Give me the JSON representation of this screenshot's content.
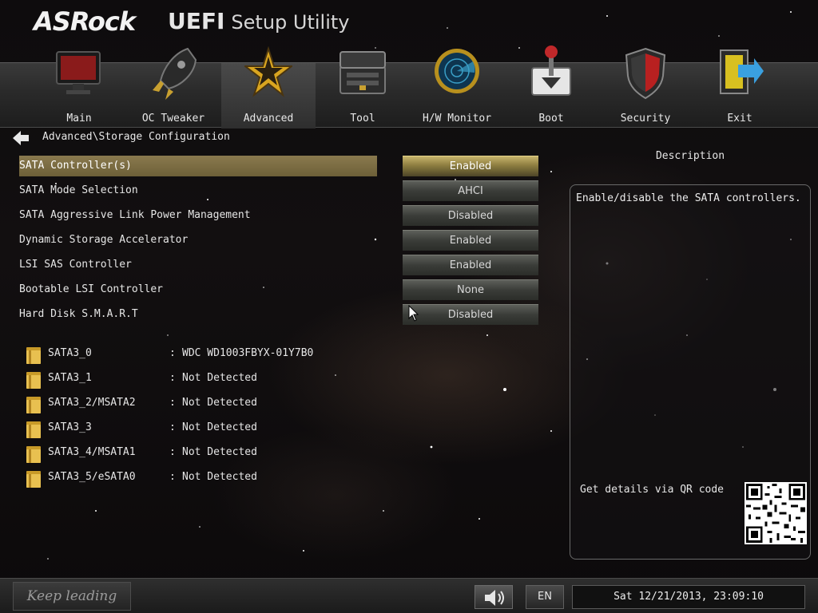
{
  "header": {
    "brand": "ASRock",
    "product_bold": "UEFI",
    "product_sub": "Setup Utility"
  },
  "tabs": [
    {
      "label": "Main",
      "icon": "monitor-icon",
      "active": false
    },
    {
      "label": "OC Tweaker",
      "icon": "rocket-icon",
      "active": false
    },
    {
      "label": "Advanced",
      "icon": "star-icon",
      "active": true
    },
    {
      "label": "Tool",
      "icon": "toolbox-icon",
      "active": false
    },
    {
      "label": "H/W Monitor",
      "icon": "radar-icon",
      "active": false
    },
    {
      "label": "Boot",
      "icon": "joystick-icon",
      "active": false
    },
    {
      "label": "Security",
      "icon": "shield-icon",
      "active": false
    },
    {
      "label": "Exit",
      "icon": "exit-door-icon",
      "active": false
    }
  ],
  "breadcrumb": {
    "path": "Advanced\\Storage Configuration"
  },
  "settings": [
    {
      "label": "SATA Controller(s)",
      "value": "Enabled",
      "selected": true
    },
    {
      "label": "SATA Mode Selection",
      "value": "AHCI",
      "selected": false
    },
    {
      "label": "SATA Aggressive Link Power Management",
      "value": "Disabled",
      "selected": false
    },
    {
      "label": "Dynamic Storage Accelerator",
      "value": "Enabled",
      "selected": false
    },
    {
      "label": "LSI SAS Controller",
      "value": "Enabled",
      "selected": false
    },
    {
      "label": "Bootable LSI Controller",
      "value": "None",
      "selected": false
    },
    {
      "label": "Hard Disk S.M.A.R.T",
      "value": "Disabled",
      "selected": false
    }
  ],
  "devices": [
    {
      "port": "SATA3_0",
      "separator": ":",
      "value": "WDC WD1003FBYX-01Y7B0"
    },
    {
      "port": "SATA3_1",
      "separator": ":",
      "value": "Not Detected"
    },
    {
      "port": "SATA3_2/MSATA2",
      "separator": ":",
      "value": "Not Detected"
    },
    {
      "port": "SATA3_3",
      "separator": ":",
      "value": "Not Detected"
    },
    {
      "port": "SATA3_4/MSATA1",
      "separator": ":",
      "value": "Not Detected"
    },
    {
      "port": "SATA3_5/eSATA0",
      "separator": ":",
      "value": "Not Detected"
    }
  ],
  "description": {
    "title": "Description",
    "text": "Enable/disable the SATA controllers.",
    "qr_label": "Get details via QR code"
  },
  "footer": {
    "slogan": "Keep leading",
    "language": "EN",
    "datetime": "Sat 12/21/2013, 23:09:10"
  },
  "colors": {
    "selected_row": "#8a7a4e",
    "selected_value": "#c7b46b",
    "value_button": "#4a4c48",
    "tabbar": "#2a2a2a"
  }
}
